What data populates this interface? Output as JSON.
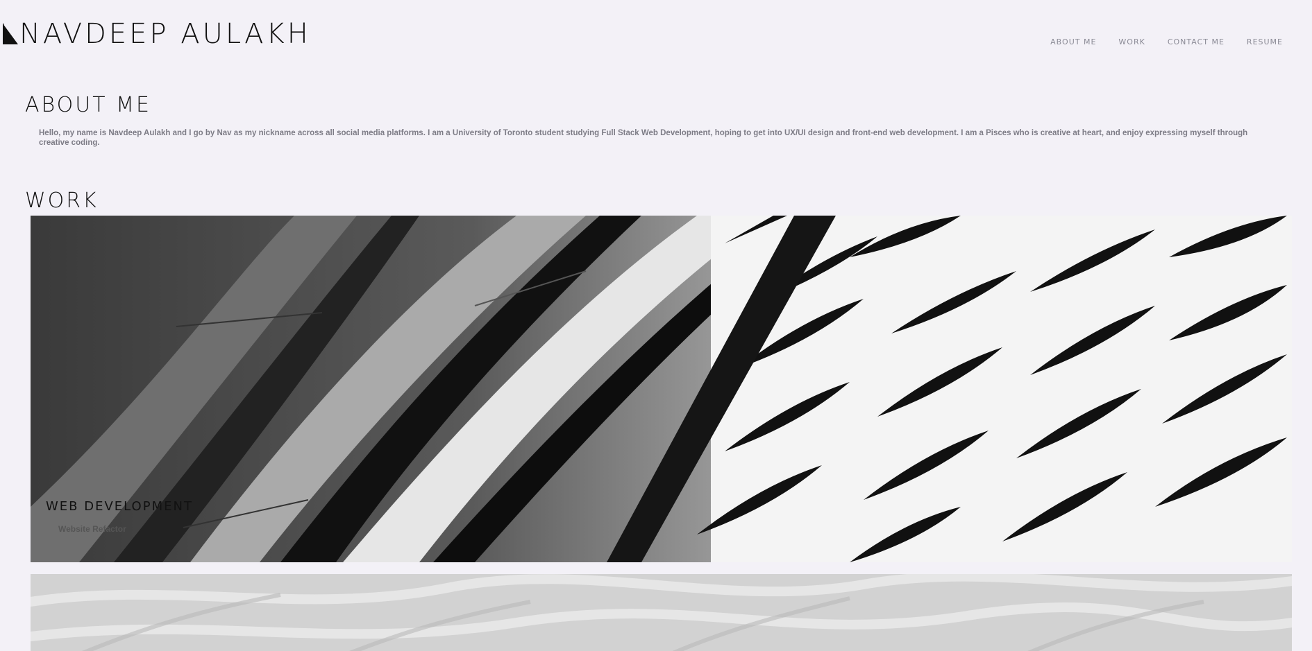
{
  "header": {
    "site_name": "NAVDEEP AULAKH",
    "nav": [
      "ABOUT ME",
      "WORK",
      "CONTACT ME",
      "RESUME"
    ]
  },
  "about": {
    "heading": "ABOUT ME",
    "text": "Hello, my name is Navdeep Aulakh and I go by Nav as my nickname across all social media platforms. I am a University of Toronto student studying Full Stack Web Development, hoping to get into UX/UI design and front-end web development. I am a Pisces who is creative at heart, and enjoy expressing myself through creative coding."
  },
  "work": {
    "heading": "WORK",
    "projects": [
      {
        "title": "WEB DEVELOPMENT",
        "subtitle": "Website Refactor"
      }
    ]
  },
  "colors": {
    "background": "#f3f1f7",
    "heading": "#111111",
    "body_text": "#7d7c86",
    "nav_text": "#8a8a95"
  },
  "icons": [
    "name-mark-icon"
  ]
}
